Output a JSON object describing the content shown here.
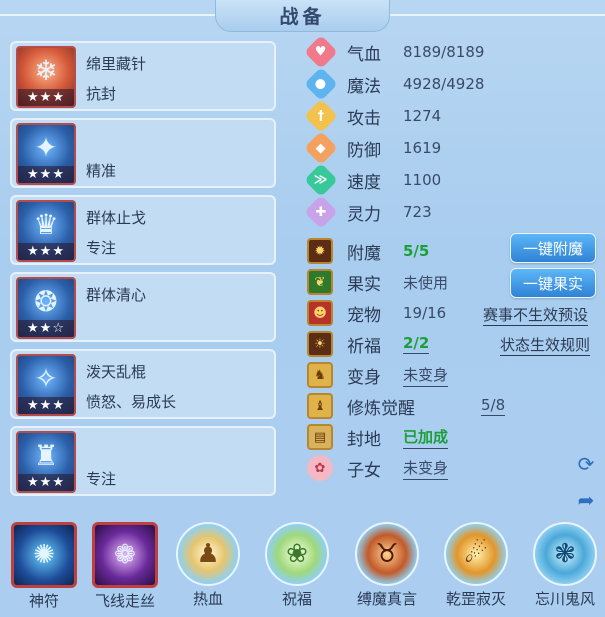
{
  "header": {
    "title": "战备"
  },
  "skills": [
    {
      "name": "绵里藏针",
      "effect": "抗封",
      "stars": "★★★",
      "icon": "ice-stick-icon"
    },
    {
      "name": "",
      "effect": "精准",
      "stars": "★★★",
      "icon": "blue-spirit-icon"
    },
    {
      "name": "群体止戈",
      "effect": "专注",
      "stars": "★★★",
      "icon": "blue-warrior-icon"
    },
    {
      "name": "群体清心",
      "effect": "",
      "stars": "★★☆",
      "icon": "blue-mind-icon"
    },
    {
      "name": "泼天乱棍",
      "effect": "愤怒、易成长",
      "stars": "★★★",
      "icon": "blue-staff-icon"
    },
    {
      "name": "",
      "effect": "专注",
      "stars": "★★★",
      "icon": "blue-crown-icon"
    }
  ],
  "stats": [
    {
      "label": "气血",
      "value": "8189/8189",
      "icon": "heart-icon",
      "color": "#f07a8c"
    },
    {
      "label": "魔法",
      "value": "4928/4928",
      "icon": "mana-icon",
      "color": "#5fb3ee"
    },
    {
      "label": "攻击",
      "value": "1274",
      "icon": "sword-icon",
      "color": "#f3c24c"
    },
    {
      "label": "防御",
      "value": "1619",
      "icon": "shield-icon",
      "color": "#f4a05e"
    },
    {
      "label": "速度",
      "value": "1100",
      "icon": "speed-icon",
      "color": "#38c99a"
    },
    {
      "label": "灵力",
      "value": "723",
      "icon": "spirit-icon",
      "color": "#c9a3ea"
    }
  ],
  "extras": [
    {
      "label": "附魔",
      "value": "5/5",
      "icon": "enchant-icon"
    },
    {
      "label": "果实",
      "value": "未使用",
      "icon": "fruit-icon"
    },
    {
      "label": "宠物",
      "value": "19/16",
      "icon": "pet-icon"
    },
    {
      "label": "祈福",
      "value": "2/2",
      "icon": "pray-icon"
    },
    {
      "label": "变身",
      "value": "未变身",
      "icon": "transform-icon"
    },
    {
      "label": "修炼觉醒",
      "value": "5/8",
      "icon": "cultivate-icon"
    },
    {
      "label": "封地",
      "value": "已加成",
      "icon": "fief-icon"
    },
    {
      "label": "子女",
      "value": "未变身",
      "icon": "child-icon"
    }
  ],
  "buttons": {
    "enchant": "一键附魔",
    "fruit": "一键果实"
  },
  "links": {
    "preset": "赛事不生效预设",
    "rules": "状态生效规则"
  },
  "side_icons": {
    "refresh": "refresh-icon",
    "share": "share-icon"
  },
  "bottom_skills": [
    {
      "name": "神符",
      "icon": "rune-orb-icon"
    },
    {
      "name": "飞线走丝",
      "icon": "purple-orb-icon"
    },
    {
      "name": "热血",
      "icon": "fighter-icon"
    },
    {
      "name": "祝福",
      "icon": "blessing-icon"
    },
    {
      "name": "缚魔真言",
      "icon": "demon-bind-icon"
    },
    {
      "name": "乾罡寂灭",
      "icon": "strike-icon"
    },
    {
      "name": "忘川鬼风",
      "icon": "ghost-wind-icon"
    }
  ]
}
